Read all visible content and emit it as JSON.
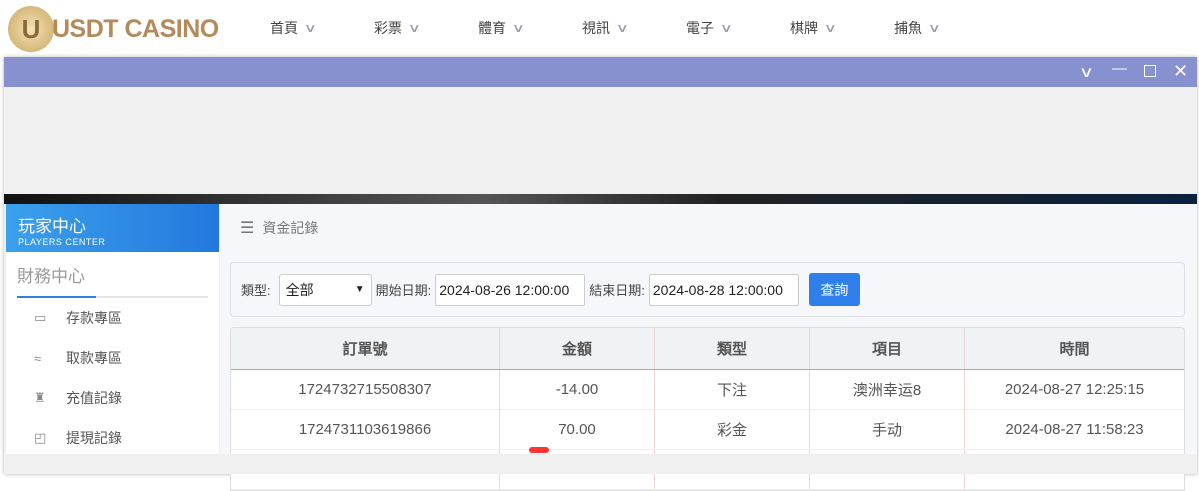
{
  "header": {
    "logo_letter": "U",
    "logo_text": "USDT CASINO",
    "nav": [
      "首頁",
      "彩票",
      "體育",
      "視訊",
      "電子",
      "棋牌",
      "捕魚"
    ]
  },
  "window": {
    "controls": [
      "chevron-down",
      "minimize",
      "maximize",
      "close"
    ]
  },
  "sidebar": {
    "title": "玩家中心",
    "subtitle": "PLAYERS CENTER",
    "section": "財務中心",
    "items": [
      {
        "label": "存款專區",
        "icon": "card-icon"
      },
      {
        "label": "取款專區",
        "icon": "hand-icon"
      },
      {
        "label": "充值記錄",
        "icon": "money-bag-icon"
      },
      {
        "label": "提現記錄",
        "icon": "wallet-icon"
      }
    ]
  },
  "main": {
    "breadcrumb": "資金記錄",
    "filter": {
      "type_label": "類型:",
      "type_value": "全部",
      "start_label": "開始日期:",
      "start_value": "2024-08-26 12:00:00",
      "end_label": "結束日期:",
      "end_value": "2024-08-28 12:00:00",
      "search": "查詢"
    },
    "table": {
      "columns": [
        "訂單號",
        "金額",
        "類型",
        "項目",
        "時間"
      ],
      "rows": [
        [
          "1724732715508307",
          "-14.00",
          "下注",
          "澳洲幸运8",
          "2024-08-27 12:25:15"
        ],
        [
          "1724731103619866",
          "70.00",
          "彩金",
          "手动",
          "2024-08-27 11:58:23"
        ]
      ]
    }
  },
  "colors": {
    "titlebar": "#8791cf",
    "accent": "#2f7fea"
  }
}
